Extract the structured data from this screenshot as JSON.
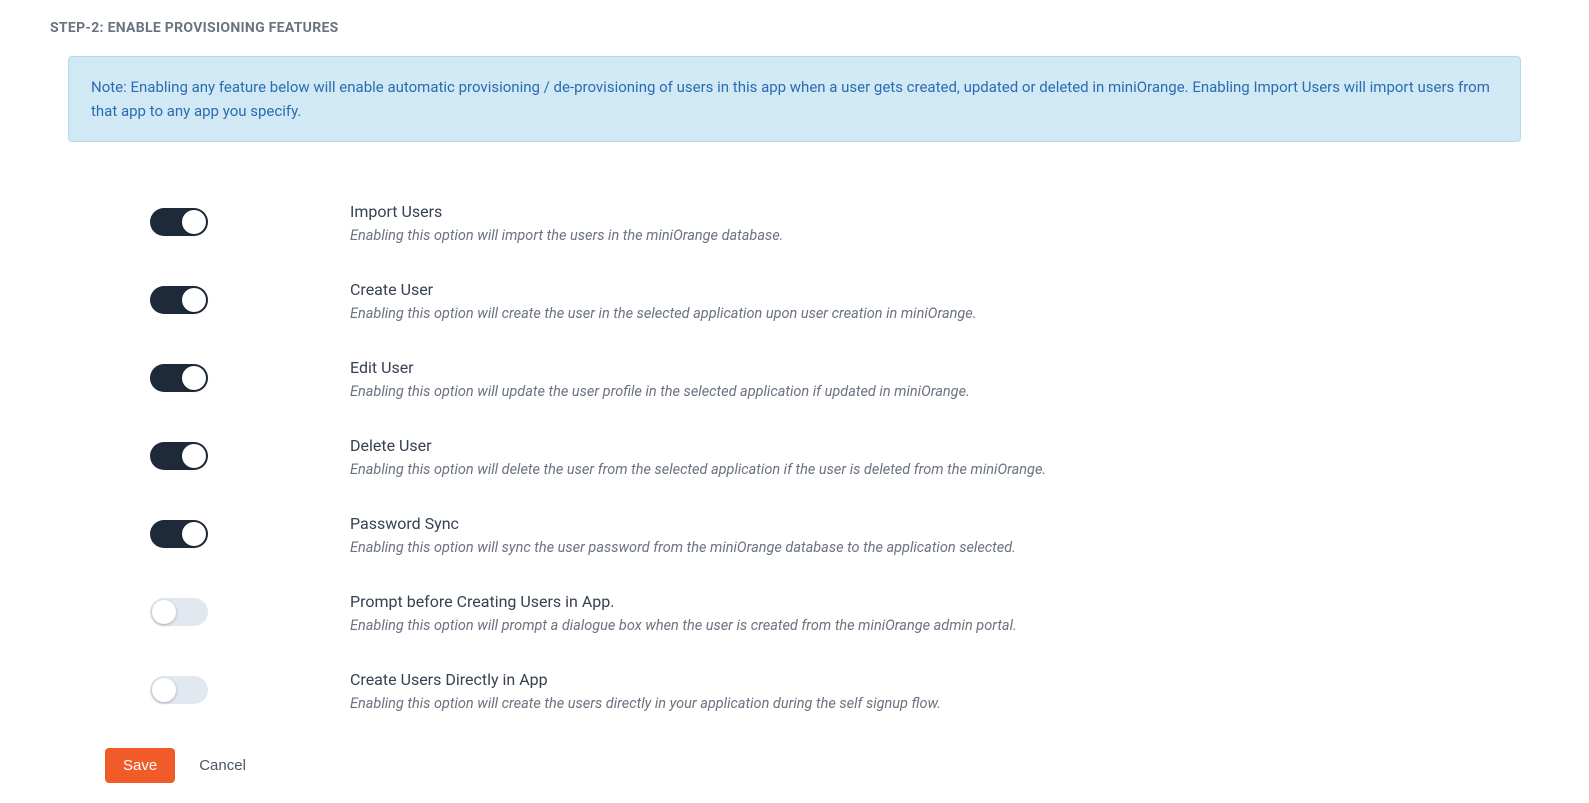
{
  "step_title": "STEP-2: ENABLE PROVISIONING FEATURES",
  "info_note": "Note: Enabling any feature below will enable automatic provisioning / de-provisioning of users in this app when a user gets created, updated or deleted in miniOrange. Enabling Import Users will import users from that app to any app you specify.",
  "features": [
    {
      "title": "Import Users",
      "desc": "Enabling this option will import the users in the miniOrange database.",
      "enabled": true
    },
    {
      "title": "Create User",
      "desc": "Enabling this option will create the user in the selected application upon user creation in miniOrange.",
      "enabled": true
    },
    {
      "title": "Edit User",
      "desc": "Enabling this option will update the user profile in the selected application if updated in miniOrange.",
      "enabled": true
    },
    {
      "title": "Delete User",
      "desc": "Enabling this option will delete the user from the selected application if the user is deleted from the miniOrange.",
      "enabled": true
    },
    {
      "title": "Password Sync",
      "desc": "Enabling this option will sync the user password from the miniOrange database to the application selected.",
      "enabled": true
    },
    {
      "title": "Prompt before Creating Users in App.",
      "desc": "Enabling this option will prompt a dialogue box when the user is created from the miniOrange admin portal.",
      "enabled": false
    },
    {
      "title": "Create Users Directly in App",
      "desc": "Enabling this option will create the users directly in your application during the self signup flow.",
      "enabled": false
    }
  ],
  "actions": {
    "save_label": "Save",
    "cancel_label": "Cancel"
  }
}
